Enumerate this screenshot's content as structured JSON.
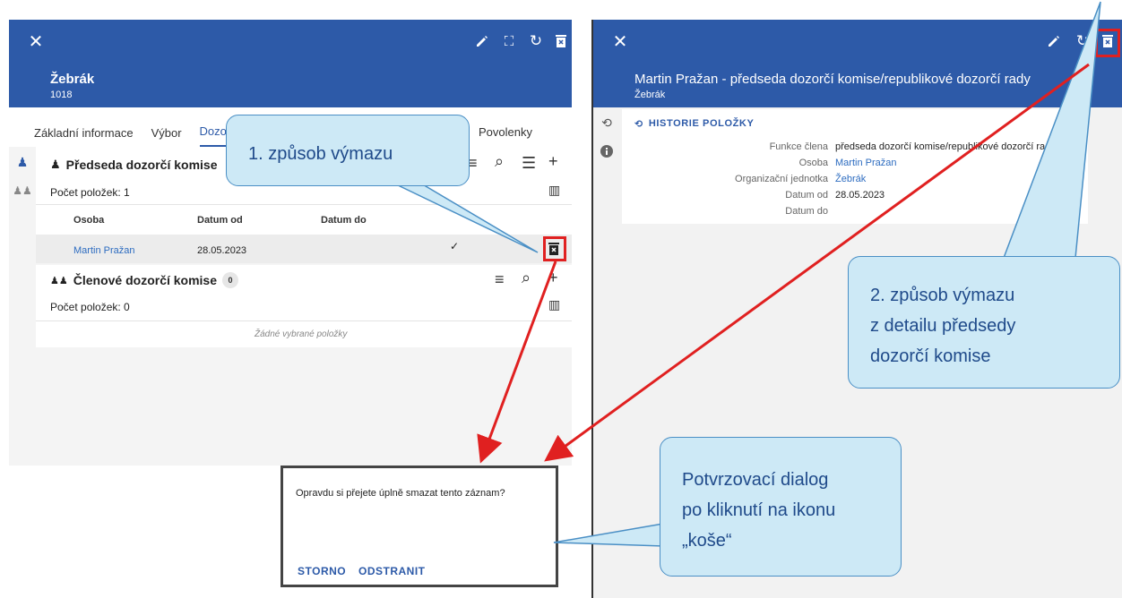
{
  "left_panel": {
    "title": "Žebrák",
    "subtitle": "1018",
    "tabs": [
      "Základní informace",
      "Výbor",
      "Dozor",
      "Povolenky"
    ],
    "section1": {
      "title": "Předseda dozorčí komise",
      "count_label": "Počet položek: 1",
      "columns": [
        "Osoba",
        "Datum od",
        "Datum do"
      ],
      "row": {
        "osoba": "Martin Pražan",
        "datum_od": "28.05.2023",
        "check": "✓"
      }
    },
    "section2": {
      "title": "Členové dozorčí komise",
      "badge": "0",
      "count_label": "Počet položek: 0",
      "empty": "Žádné vybrané položky"
    }
  },
  "right_panel": {
    "title": "Martin Pražan - předseda dozorčí komise/republikové dozorčí rady",
    "subtitle": "Žebrák",
    "history_label": "HISTORIE POLOŽKY",
    "fields": [
      {
        "label": "Funkce člena",
        "value": "předseda dozorčí komise/republikové dozorčí rady"
      },
      {
        "label": "Osoba",
        "value": "Martin Pražan"
      },
      {
        "label": "Organizační jednotka",
        "value": "Žebrák"
      },
      {
        "label": "Datum od",
        "value": "28.05.2023"
      },
      {
        "label": "Datum do",
        "value": ""
      }
    ]
  },
  "dialog": {
    "message": "Opravdu si přejete úplně smazat tento záznam?",
    "cancel": "STORNO",
    "confirm": "ODSTRANIT"
  },
  "callouts": {
    "c1": "1. způsob výmazu",
    "c2_line1": "2. způsob výmazu",
    "c2_line2": "z detailu předsedy",
    "c2_line3": "dozorčí komise",
    "c3_line1": "Potvrzovací dialog",
    "c3_line2": "po kliknutí na ikonu",
    "c3_line3": "„koše“"
  },
  "colors": {
    "header": "#2d5aa8",
    "link": "#2d6cc0",
    "callout_fill": "#cde9f6",
    "highlight": "#e02020"
  }
}
